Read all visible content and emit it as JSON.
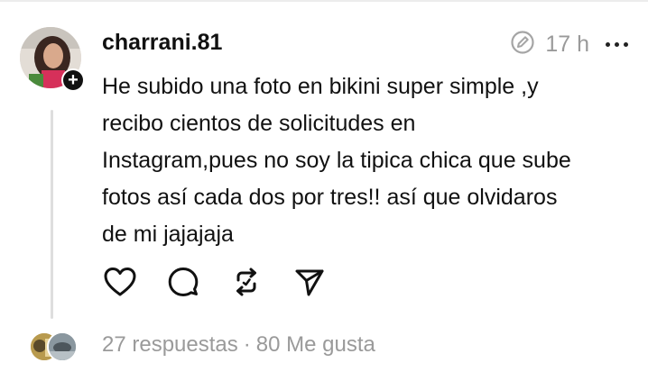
{
  "post": {
    "username": "charrani.81",
    "time": "17 h",
    "text": "He subido una foto en bikini super simple ,y\nrecibo cientos de solicitudes en\nInstagram,pues no soy la tipica chica que sube\nfotos así cada dos por tres!! así que olvidaros\nde mi jajajaja",
    "icons": {
      "follow": "plus-icon",
      "time_status": "pen-circle-icon",
      "more": "more-icon",
      "like": "heart-icon",
      "reply": "comment-icon",
      "repost": "repost-icon",
      "share": "send-icon"
    }
  },
  "footer": {
    "replies": "27 respuestas",
    "separator": "·",
    "likes": "80 Me gusta"
  }
}
